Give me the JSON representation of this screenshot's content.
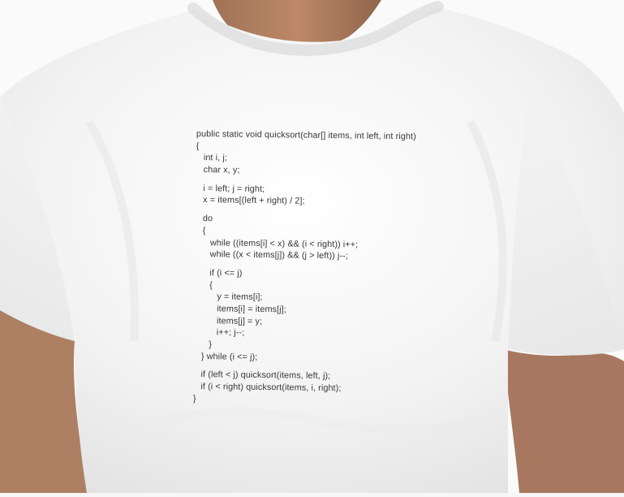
{
  "code_lines": [
    "public static void quicksort(char[] items, int left, int right)",
    "{",
    "   int i, j;",
    "   char x, y;",
    "",
    "   i = left; j = right;",
    "   x = items[(left + right) / 2];",
    "",
    "   do",
    "   {",
    "      while ((items[i] < x) && (i < right)) i++;",
    "      while ((x < items[j]) && (j > left)) j--;",
    "",
    "      if (i <= j)",
    "      {",
    "         y = items[i];",
    "         items[i] = items[j];",
    "         items[j] = y;",
    "         i++; j--;",
    "      }",
    "   } while (i <= j);",
    "",
    "   if (left < j) quicksort(items, left, j);",
    "   if (i < right) quicksort(items, i, right);",
    "}"
  ],
  "colors": {
    "shirt": "#f4f4f4",
    "skin": "#b07c5b",
    "ink": "#2b2b2b"
  }
}
